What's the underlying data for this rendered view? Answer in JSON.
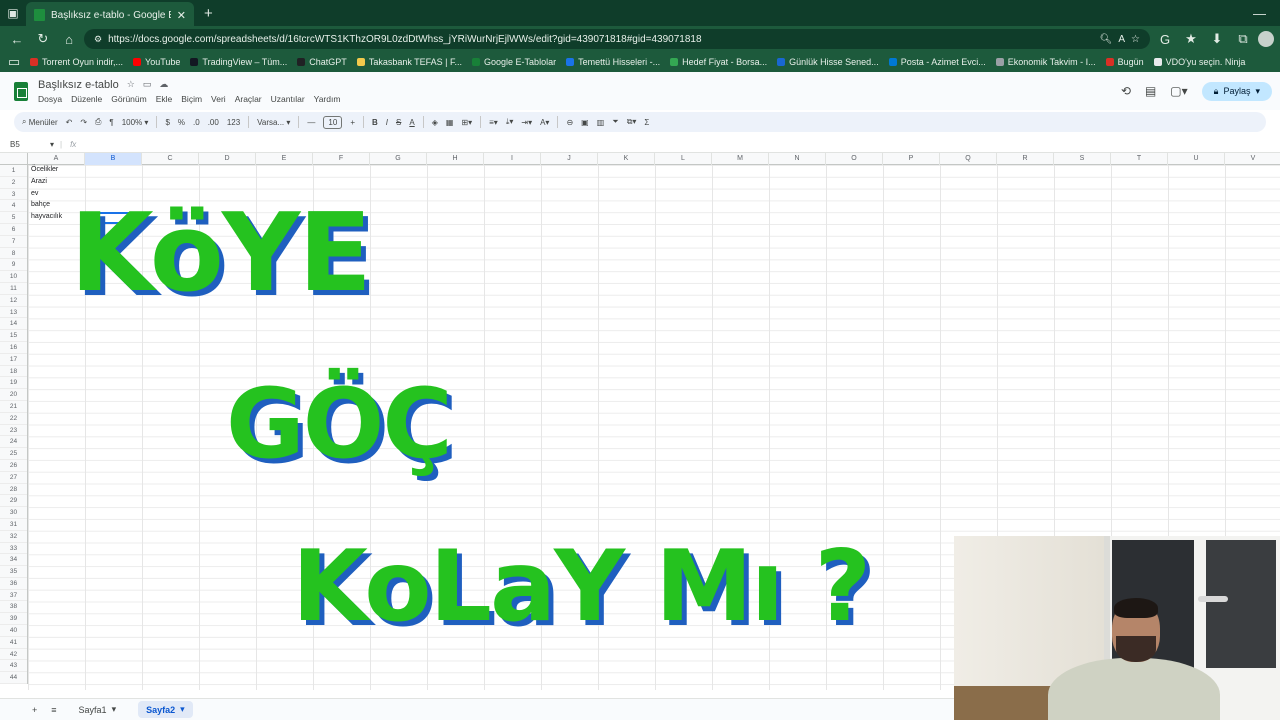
{
  "browser": {
    "tab_title": "Başlıksız e-tablo - Google E-Tablo",
    "url": "https://docs.google.com/spreadsheets/d/16tcrcWTS1KThzOR9L0zdDtWhss_jYRiWurNrjEjlWWs/edit?gid=439071818#gid=439071818",
    "bookmarks": [
      {
        "label": "Torrent Oyun indir,...",
        "color": "#d93025"
      },
      {
        "label": "YouTube",
        "color": "#ff0000"
      },
      {
        "label": "TradingView – Tüm...",
        "color": "#131722"
      },
      {
        "label": "ChatGPT",
        "color": "#202124"
      },
      {
        "label": "Takasbank TEFAS | F...",
        "color": "#f2c94c"
      },
      {
        "label": "Google E-Tablolar",
        "color": "#188038"
      },
      {
        "label": "Temettü Hisseleri -...",
        "color": "#1a73e8"
      },
      {
        "label": "Hedef Fiyat - Borsa...",
        "color": "#34a853"
      },
      {
        "label": "Günlük Hisse Sened...",
        "color": "#1967d2"
      },
      {
        "label": "Posta - Azimet Evci...",
        "color": "#0078d4"
      },
      {
        "label": "Ekonomik Takvim - I...",
        "color": "#9aa0a6"
      },
      {
        "label": "Bugün",
        "color": "#d93025"
      },
      {
        "label": "VDO'yu seçin. Ninja",
        "color": "#e8eaed"
      }
    ]
  },
  "sheets": {
    "doc_title": "Başlıksız e-tablo",
    "menus": [
      "Dosya",
      "Düzenle",
      "Görünüm",
      "Ekle",
      "Biçim",
      "Veri",
      "Araçlar",
      "Uzantılar",
      "Yardım"
    ],
    "share_label": "Paylaş",
    "toolbar": {
      "search": "Menüler",
      "zoom": "100%",
      "currency": "$",
      "percent": "%",
      "dec_less": ".0",
      "dec_more": ".00",
      "num_format": "123",
      "font": "Varsa...",
      "font_size": "10"
    },
    "name_box": "B5",
    "fx": "fx",
    "columns": [
      "A",
      "B",
      "C",
      "D",
      "E",
      "F",
      "G",
      "H",
      "I",
      "J",
      "K",
      "L",
      "M",
      "N",
      "O",
      "P",
      "Q",
      "R",
      "S",
      "T",
      "U",
      "V"
    ],
    "row_count": 44,
    "cells": [
      "Öcelikler",
      "Arazi",
      "ev",
      "bahçe",
      "hayvacılık"
    ],
    "sheet_tabs": [
      "Sayfa1",
      "Sayfa2"
    ]
  },
  "overlay": {
    "line1": "KöYE",
    "line2": "GÖÇ",
    "line3": "KoLaY Mı ?",
    "fill_color": "#25c21f",
    "shadow_color": "#1f5fbf"
  }
}
